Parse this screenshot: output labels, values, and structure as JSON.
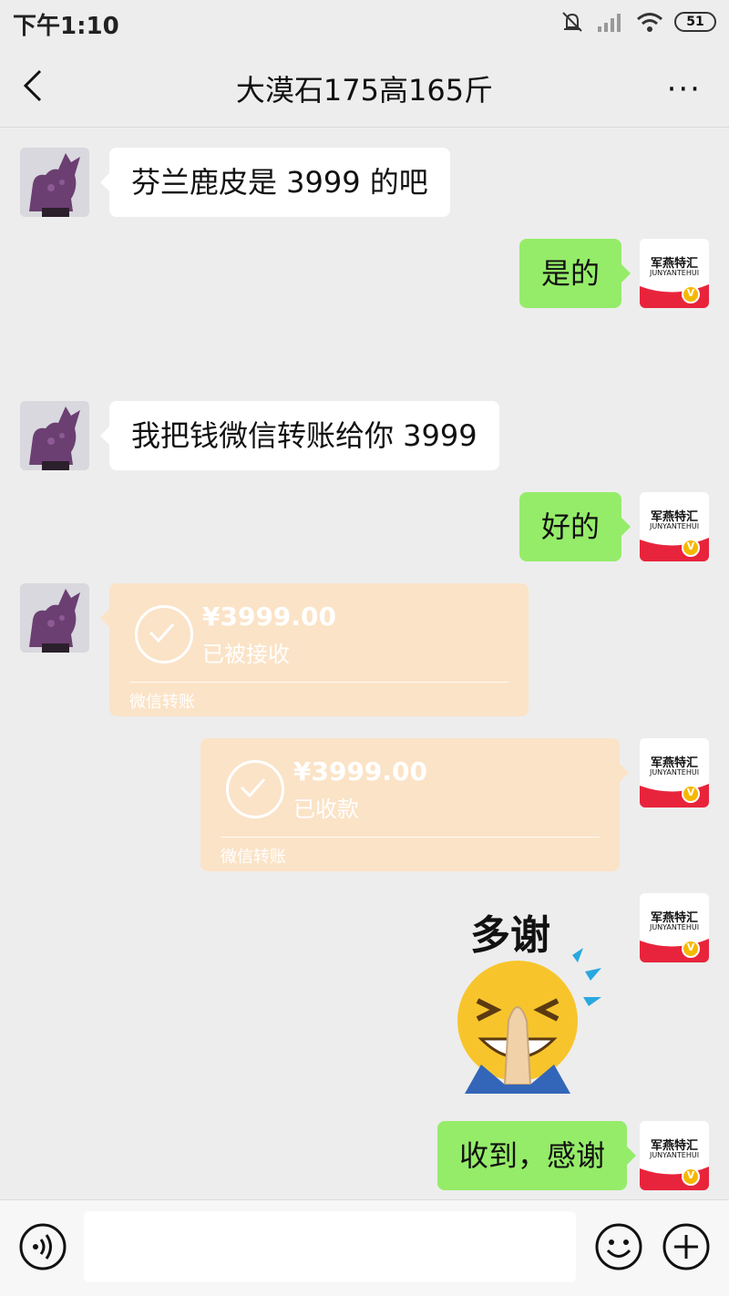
{
  "status_bar": {
    "time": "下午1:10",
    "battery": "51"
  },
  "header": {
    "title": "大漠石175高165斤",
    "more": "···"
  },
  "me_avatar_text": {
    "line1": "军燕特汇",
    "line2": "JUNYANTEHUI",
    "badge": "V"
  },
  "messages": {
    "m1": "芬兰鹿皮是 3999 的吧",
    "m2": "是的",
    "m3": "我把钱微信转账给你 3999",
    "m4": "好的",
    "m8": "收到，感谢"
  },
  "transfer_in": {
    "amount": "¥3999.00",
    "status": "已被接收",
    "label": "微信转账"
  },
  "transfer_out": {
    "amount": "¥3999.00",
    "status": "已收款",
    "label": "微信转账"
  },
  "sticker": {
    "text": "多谢"
  }
}
